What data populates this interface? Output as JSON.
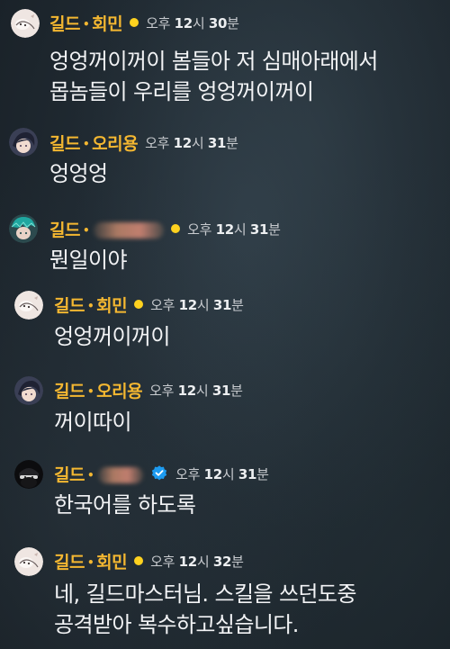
{
  "messages": [
    {
      "guild": "길드",
      "separator": "•",
      "user": "회민",
      "time_prefix": "오후",
      "time_hour": "12",
      "time_hour_unit": "시",
      "time_min": "30",
      "time_min_unit": "분",
      "lines": [
        "엉엉꺼이꺼이 봄들아 저 심매아래에서",
        "몹놈들이 우리를 엉엉꺼이꺼이"
      ]
    },
    {
      "guild": "길드",
      "separator": "•",
      "user": "오리용",
      "time_prefix": "오후",
      "time_hour": "12",
      "time_hour_unit": "시",
      "time_min": "31",
      "time_min_unit": "분",
      "lines": [
        "엉엉엉"
      ]
    },
    {
      "guild": "길드",
      "separator": "•",
      "user": "",
      "time_prefix": "오후",
      "time_hour": "12",
      "time_hour_unit": "시",
      "time_min": "31",
      "time_min_unit": "분",
      "lines": [
        "뭔일이야"
      ]
    },
    {
      "guild": "길드",
      "separator": "•",
      "user": "회민",
      "time_prefix": "오후",
      "time_hour": "12",
      "time_hour_unit": "시",
      "time_min": "31",
      "time_min_unit": "분",
      "lines": [
        "엉엉꺼이꺼이"
      ]
    },
    {
      "guild": "길드",
      "separator": "•",
      "user": "오리용",
      "time_prefix": "오후",
      "time_hour": "12",
      "time_hour_unit": "시",
      "time_min": "31",
      "time_min_unit": "분",
      "lines": [
        "꺼이따이"
      ]
    },
    {
      "guild": "길드",
      "separator": "•",
      "user": "",
      "time_prefix": "오후",
      "time_hour": "12",
      "time_hour_unit": "시",
      "time_min": "31",
      "time_min_unit": "분",
      "lines": [
        "한국어를 하도록"
      ]
    },
    {
      "guild": "길드",
      "separator": "•",
      "user": "회민",
      "time_prefix": "오후",
      "time_hour": "12",
      "time_hour_unit": "시",
      "time_min": "32",
      "time_min_unit": "분",
      "lines": [
        "네, 길드마스터님. 스킬을 쓰던도중",
        "공격받아 복수하고싶습니다."
      ]
    }
  ],
  "colors": {
    "name": "#f4b731",
    "status_dot": "#ffd21f",
    "verified": "#1d9bf0",
    "message_text": "#f2f3f5",
    "timestamp": "#c8cbcf"
  },
  "icons": {
    "status": "online-status-dot-icon",
    "verified": "verified-check-badge-icon"
  }
}
